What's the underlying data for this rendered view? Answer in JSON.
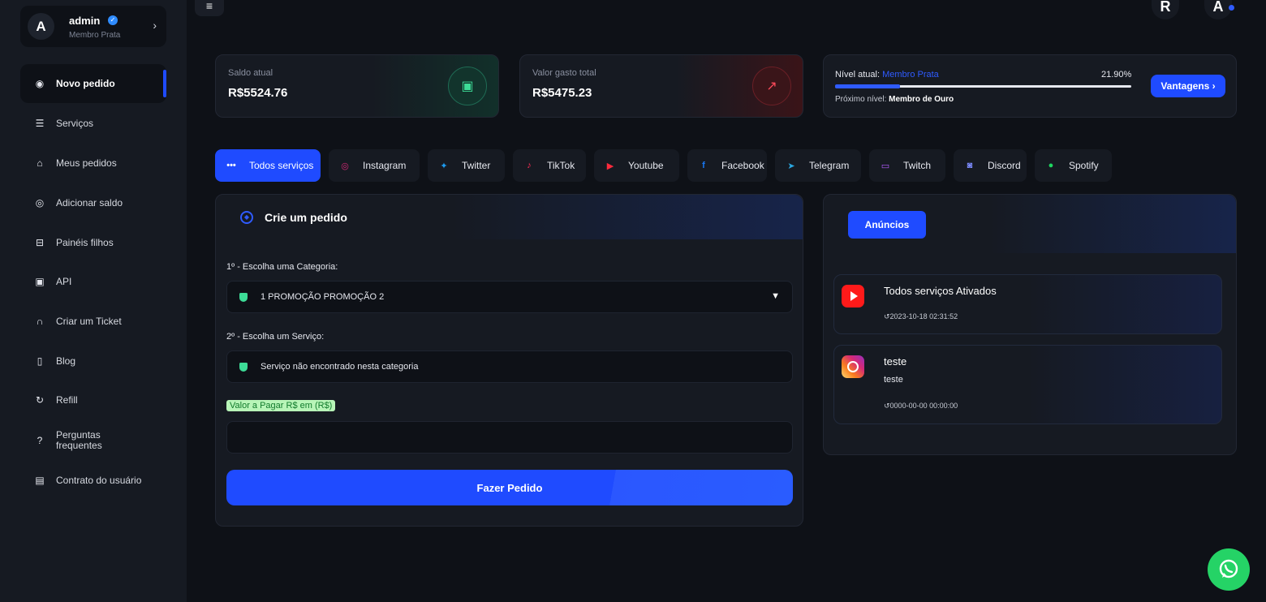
{
  "profile": {
    "avatar_letter": "A",
    "name": "admin",
    "rank": "Membro Prata"
  },
  "sidebar": {
    "items": [
      {
        "label": "Novo pedido",
        "icon": "gauge-icon"
      },
      {
        "label": "Serviços",
        "icon": "list-icon"
      },
      {
        "label": "Meus pedidos",
        "icon": "basket-icon"
      },
      {
        "label": "Adicionar saldo",
        "icon": "coin-icon"
      },
      {
        "label": "Painéis filhos",
        "icon": "store-icon"
      },
      {
        "label": "API",
        "icon": "terminal-icon"
      },
      {
        "label": "Criar um Ticket",
        "icon": "headset-icon"
      },
      {
        "label": "Blog",
        "icon": "book-icon"
      },
      {
        "label": "Refill",
        "icon": "refresh-icon"
      },
      {
        "label": "Perguntas frequentes",
        "icon": "question-icon"
      },
      {
        "label": "Contrato do usuário",
        "icon": "document-icon"
      }
    ]
  },
  "topbar": {
    "menu_icon": "≡",
    "avatar1": "R",
    "avatar2": "A"
  },
  "stats": {
    "saldo_label": "Saldo atual",
    "saldo_value": "R$5524.76",
    "gasto_label": "Valor gasto total",
    "gasto_value": "R$5475.23"
  },
  "level": {
    "label": "Nível atual:",
    "current": "Membro Prata",
    "percent_text": "21.90%",
    "progress_fraction": 0.219,
    "next_label": "Próximo nível:",
    "next": "Membro de Ouro",
    "button": "Vantagens ›"
  },
  "tabs": [
    {
      "label": "Todos serviços",
      "icon": "dots-icon",
      "active": true
    },
    {
      "label": "Instagram",
      "icon": "instagram-icon"
    },
    {
      "label": "Twitter",
      "icon": "twitter-icon"
    },
    {
      "label": "TikTok",
      "icon": "tiktok-icon"
    },
    {
      "label": "Youtube",
      "icon": "youtube-icon"
    },
    {
      "label": "Facebook",
      "icon": "facebook-icon"
    },
    {
      "label": "Telegram",
      "icon": "telegram-icon"
    },
    {
      "label": "Twitch",
      "icon": "twitch-icon"
    },
    {
      "label": "Discord",
      "icon": "discord-icon"
    },
    {
      "label": "Spotify",
      "icon": "spotify-icon"
    }
  ],
  "order": {
    "title": "Crie um pedido",
    "category_label": "1º - Escolha uma Categoria:",
    "category_value": "1 PROMOÇÃO PROMOÇÃO 2",
    "service_label": "2º - Escolha um Serviço:",
    "service_value": "Serviço não encontrado nesta categoria",
    "amount_label": "Valor a Pagar R$ em (R$)",
    "amount_value": "",
    "submit": "Fazer Pedido"
  },
  "announcements": {
    "button": "Anúncios",
    "items": [
      {
        "title": "Todos serviços Ativados",
        "body": "",
        "date": "2023-10-18 02:31:52",
        "icon": "youtube-icon"
      },
      {
        "title": "teste",
        "body": "teste",
        "date": "0000-00-00 00:00:00",
        "icon": "instagram-icon"
      }
    ]
  },
  "colors": {
    "accent": "#1f4bff",
    "background": "#0e1117",
    "panel": "#161a22",
    "success": "#3ddc97",
    "danger": "#ff4a5a",
    "whatsapp": "#25d366"
  }
}
